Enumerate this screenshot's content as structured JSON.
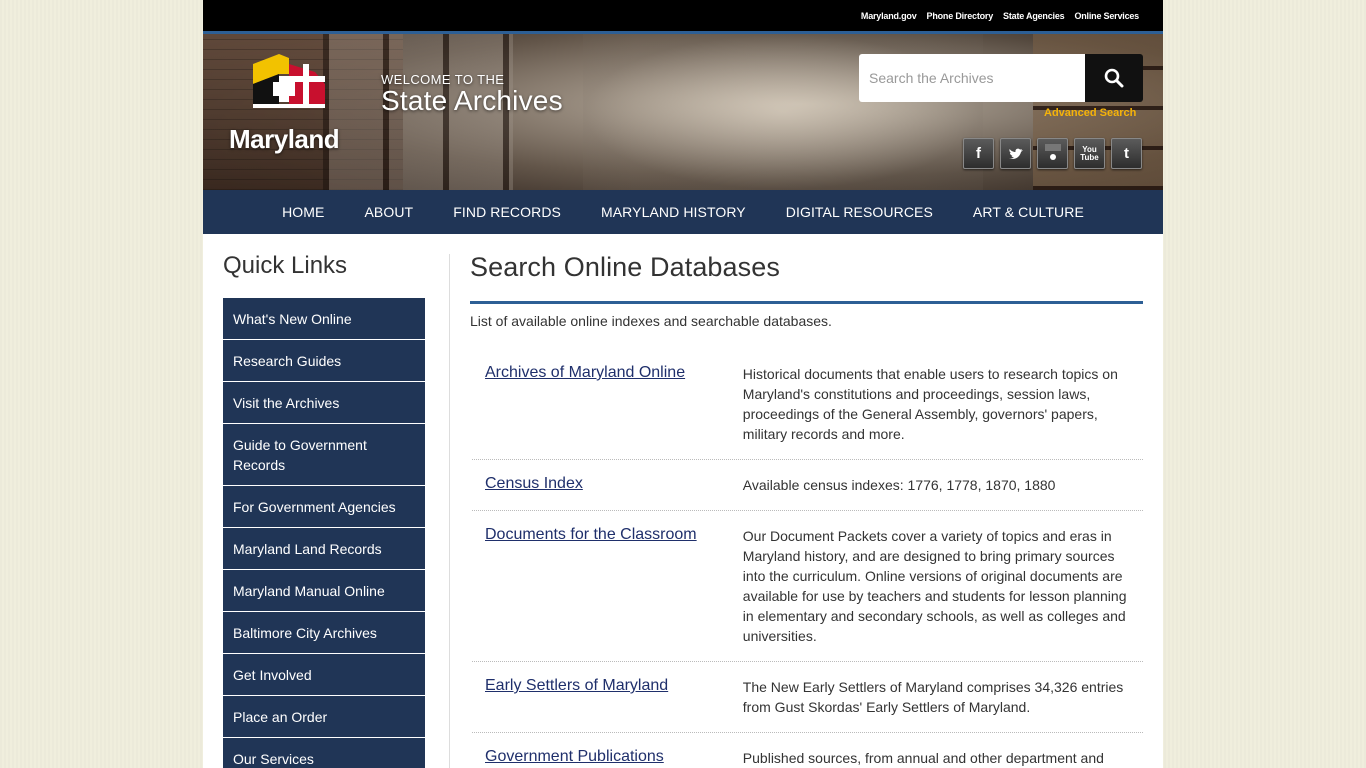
{
  "topbar": {
    "links": [
      "Maryland.gov",
      "Phone Directory",
      "State Agencies",
      "Online Services"
    ]
  },
  "header": {
    "logo_text": "Maryland",
    "welcome_line1": "WELCOME TO THE",
    "welcome_line2": "State Archives",
    "search_placeholder": "Search the Archives",
    "advanced_search": "Advanced Search",
    "socials": [
      "facebook-icon",
      "twitter-icon",
      "flickr-icon",
      "youtube-icon",
      "tumblr-icon"
    ],
    "social_glyphs": [
      "f",
      "",
      "",
      "You\nTube",
      "t"
    ],
    "colors": {
      "accent": "#f5b30a",
      "nav": "#203556",
      "rule": "#2d5f95"
    }
  },
  "nav": [
    "HOME",
    "ABOUT",
    "FIND RECORDS",
    "MARYLAND HISTORY",
    "DIGITAL RESOURCES",
    "ART & CULTURE"
  ],
  "sidebar": {
    "title": "Quick Links",
    "items": [
      "What's New Online",
      "Research Guides",
      "Visit the Archives",
      "Guide to Government Records",
      "For Government Agencies",
      "Maryland Land Records",
      "Maryland Manual Online",
      "Baltimore City Archives",
      "Get Involved",
      "Place an Order",
      "Our Services"
    ]
  },
  "main": {
    "title": "Search Online Databases",
    "intro": "List of available online indexes and searchable databases.",
    "databases": [
      {
        "name": "Archives of Maryland Online",
        "desc": "Historical documents that enable users to research topics on Maryland's constitutions and proceedings, session laws, proceedings of the General Assembly, governors' papers, military records and more."
      },
      {
        "name": "Census Index",
        "desc": "Available census indexes: 1776, 1778, 1870, 1880"
      },
      {
        "name": "Documents for the Classroom",
        "desc": "Our Document Packets cover a variety of topics and eras in Maryland history, and are designed to bring primary sources into the curriculum. Online versions of original documents are available for use by teachers and students for lesson planning in elementary and secondary schools, as well as colleges and universities."
      },
      {
        "name": "Early Settlers of Maryland",
        "desc": "The New Early Settlers of Maryland comprises 34,326 entries from Gust Skordas' Early Settlers of Maryland."
      },
      {
        "name": "Government Publications",
        "desc": "Published sources, from annual and other department and"
      }
    ]
  }
}
